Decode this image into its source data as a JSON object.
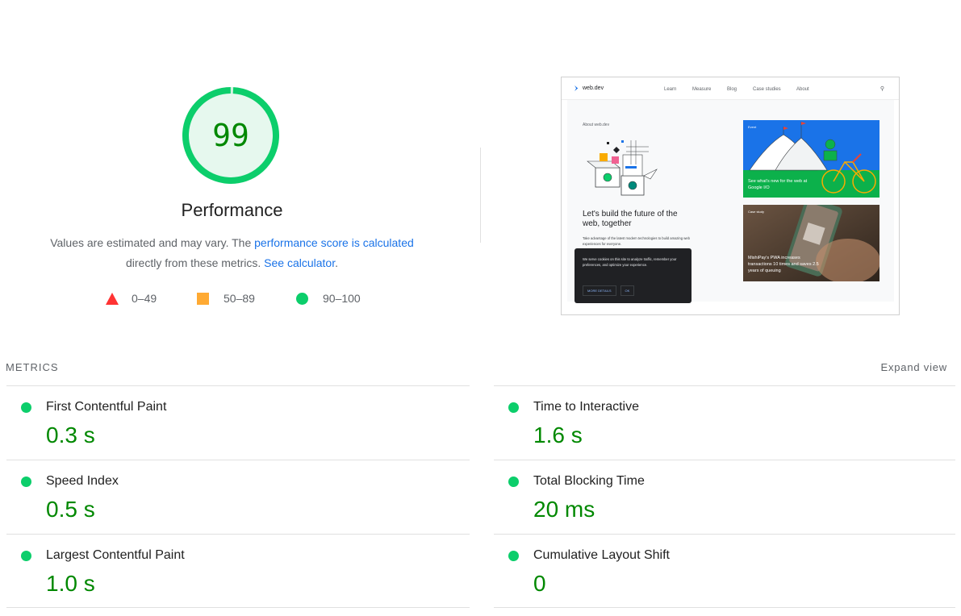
{
  "performance": {
    "score": "99",
    "score_fraction": 0.99,
    "title": "Performance",
    "desc_prefix": "Values are estimated and may vary. The ",
    "desc_link1": "performance score is calculated",
    "desc_middle": " directly from these metrics. ",
    "desc_link2": "See calculator",
    "desc_suffix": ".",
    "legend": [
      {
        "label": "0–49",
        "shape": "triangle",
        "color": "#ff3333"
      },
      {
        "label": "50–89",
        "shape": "square",
        "color": "#ffaa33"
      },
      {
        "label": "90–100",
        "shape": "circle",
        "color": "#0cce6b"
      }
    ]
  },
  "screenshot": {
    "logo": "web.dev",
    "nav": [
      "Learn",
      "Measure",
      "Blog",
      "Case studies",
      "About"
    ],
    "eyebrow": "About web.dev",
    "headline": "Let's build the future of the web, together",
    "subtext": "Take advantage of the latest modern technologies to build amazing web experiences for everyone.",
    "cookie_text": "We serve cookies on this site to analyze traffic, remember your preferences, and optimize your experience.",
    "cookie_details": "MORE DETAILS",
    "cookie_ok": "OK",
    "card1_label": "Event",
    "card1_caption": "See what's new for the web at Google I/O",
    "card2_label": "Case study",
    "card2_caption": "MishiPay's PWA increases transactions 10 times and saves 2.5 years of queuing"
  },
  "metrics": {
    "header": "METRICS",
    "expand": "Expand view",
    "left": [
      {
        "title": "First Contentful Paint",
        "value": "0.3 s"
      },
      {
        "title": "Speed Index",
        "value": "0.5 s"
      },
      {
        "title": "Largest Contentful Paint",
        "value": "1.0 s"
      }
    ],
    "right": [
      {
        "title": "Time to Interactive",
        "value": "1.6 s"
      },
      {
        "title": "Total Blocking Time",
        "value": "20 ms"
      },
      {
        "title": "Cumulative Layout Shift",
        "value": "0"
      }
    ]
  },
  "colors": {
    "pass": "#0cce6b",
    "pass_text": "#008800",
    "average": "#ffaa33",
    "fail": "#ff3333",
    "link": "#1a73e8"
  }
}
